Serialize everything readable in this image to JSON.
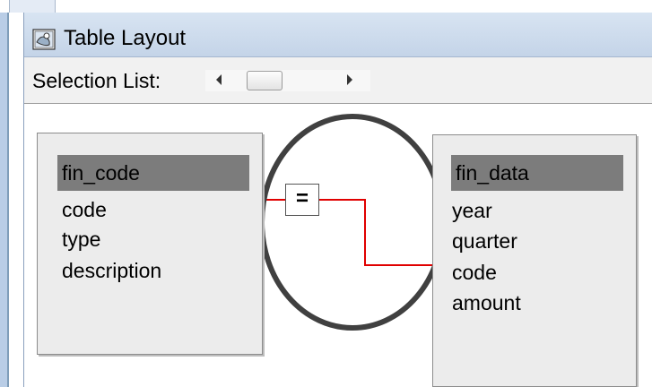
{
  "window": {
    "title": "Table Layout"
  },
  "toolbar": {
    "selection_label": "Selection List:"
  },
  "tables": [
    {
      "name": "fin_code",
      "fields": [
        "code",
        "type",
        "description"
      ]
    },
    {
      "name": "fin_data",
      "fields": [
        "year",
        "quarter",
        "code",
        "amount"
      ]
    }
  ],
  "join": {
    "operator": "="
  },
  "colors": {
    "join_line": "#e00000",
    "highlight_ellipse": "#404040",
    "table_header": "#7c7c7c",
    "titlebar": "#c9d8ea"
  },
  "icons": {
    "title_icon": "table-layout-icon"
  }
}
